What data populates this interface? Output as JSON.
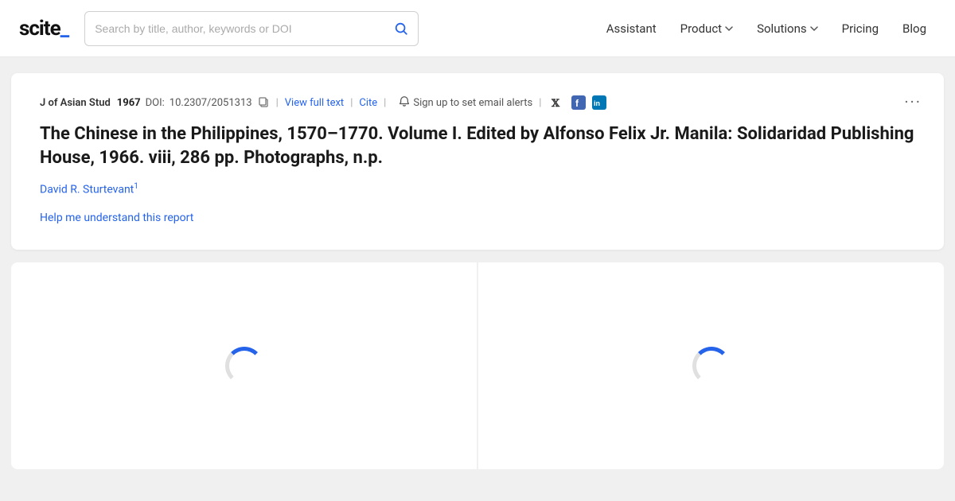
{
  "header": {
    "logo_text": "scite",
    "logo_underscore": "_",
    "search_placeholder": "Search by title, author, keywords or DOI",
    "nav_items": [
      {
        "label": "Assistant",
        "has_chevron": false
      },
      {
        "label": "Product",
        "has_chevron": true
      },
      {
        "label": "Solutions",
        "has_chevron": true
      },
      {
        "label": "Pricing",
        "has_chevron": false
      },
      {
        "label": "Blog",
        "has_chevron": false
      }
    ]
  },
  "article": {
    "journal": "J of Asian Stud",
    "year": "1967",
    "doi_label": "DOI:",
    "doi_value": "10.2307/2051313",
    "view_full_text": "View full text",
    "cite": "Cite",
    "sign_up_text": "Sign up to set email alerts",
    "title": "The Chinese in the Philippines, 1570–1770. Volume I. Edited by Alfonso Felix Jr. Manila: Solidaridad Publishing House, 1966. viii, 286 pp. Photographs, n.p.",
    "author": "David R. Sturtevant",
    "author_sup": "1",
    "help_link": "Help me understand this report",
    "more_icon": "···"
  },
  "icons": {
    "search": "🔍",
    "copy": "⧉",
    "bell": "🔔",
    "twitter": "𝕏",
    "facebook": "f",
    "linkedin": "in"
  }
}
